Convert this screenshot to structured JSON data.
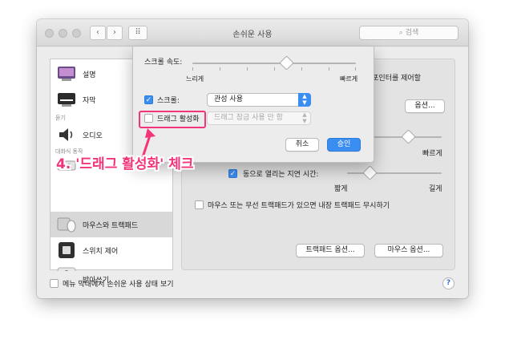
{
  "window": {
    "title": "손쉬운 사용",
    "search_placeholder": "검색",
    "nav_back": "‹",
    "nav_forward": "›",
    "grid_glyph": "⠿"
  },
  "sidebar": {
    "items": [
      {
        "label": "설명",
        "icon": "description-icon"
      },
      {
        "label": "자막",
        "icon": "captions-icon"
      },
      {
        "label": "오디오",
        "icon": "speaker-icon"
      },
      {
        "label": "키보드",
        "icon": "keyboard-icon"
      },
      {
        "label": "마우스와 트랙패드",
        "icon": "mouse-icon",
        "selected": true
      },
      {
        "label": "스위치 제어",
        "icon": "switch-control-icon"
      },
      {
        "label": "받아쓰기",
        "icon": "microphone-icon"
      }
    ],
    "group_hearing": "듣기",
    "group_interaction": "대화식 동작"
  },
  "pane": {
    "partial_text": "스 포인터를 제어할",
    "options_button": "옵션...",
    "fast_label": "빠르게",
    "spring_checkbox_label": "스프링 로딩 - 자동으로 열리는 지연 시간:",
    "spring_checkbox_visible": "동으로 열리는 지연 시간:",
    "spring_checked": true,
    "short_label": "짧게",
    "long_label": "길게",
    "ignore_trackpad_label": "마우스 또는 무선 트랙패드가 있으면 내장 트랙패드 무시하기",
    "ignore_trackpad_checked": false,
    "trackpad_options_button": "트랙패드 옵션...",
    "mouse_options_button": "마우스 옵션..."
  },
  "footer": {
    "show_status_label": "메뉴 막대에서 손쉬운 사용 상태 보기",
    "show_status_checked": false,
    "help_label": "?"
  },
  "sheet": {
    "scroll_speed_label": "스크롤 속도:",
    "slow_label": "느리게",
    "fast_label": "빠르게",
    "scroll_speed_value": 0.58,
    "scrolling_label": "스크롤:",
    "scrolling_checked": true,
    "scrolling_option": "관성 사용",
    "drag_label": "드래그 활성화",
    "drag_checked": false,
    "drag_option": "드래그 잠금 사용 안 함",
    "cancel_button": "취소",
    "ok_button": "승인"
  },
  "annotation": {
    "text": "4. '드래그 활성화' 체크",
    "color": "#f2357a"
  },
  "colors": {
    "accent": "#3b8ef1",
    "annotation": "#f2357a"
  }
}
